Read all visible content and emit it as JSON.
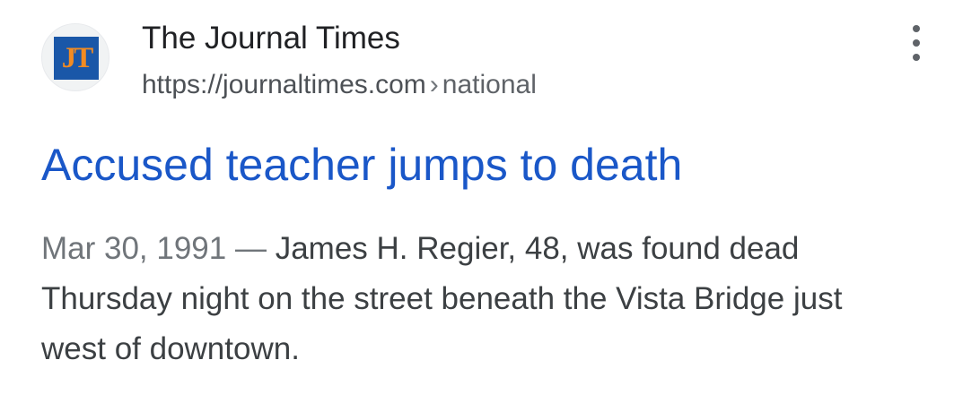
{
  "source": {
    "site_name": "The Journal Times",
    "url": "https://journaltimes.com",
    "separator": "›",
    "breadcrumb": "national",
    "favicon_text": "JT",
    "favicon_bg": "#1a57a8",
    "favicon_fg": "#f28b22"
  },
  "menu": {
    "icon": "more-vert-icon"
  },
  "result": {
    "title": "Accused teacher jumps to death",
    "date": "Mar 30, 1991",
    "dash": "—",
    "snippet": "James H. Regier, 48, was found dead Thursday night on the street beneath the Vista Bridge just west of downtown."
  },
  "colors": {
    "title_link": "#1a57c8",
    "text": "#3c4043",
    "muted": "#70757a"
  }
}
